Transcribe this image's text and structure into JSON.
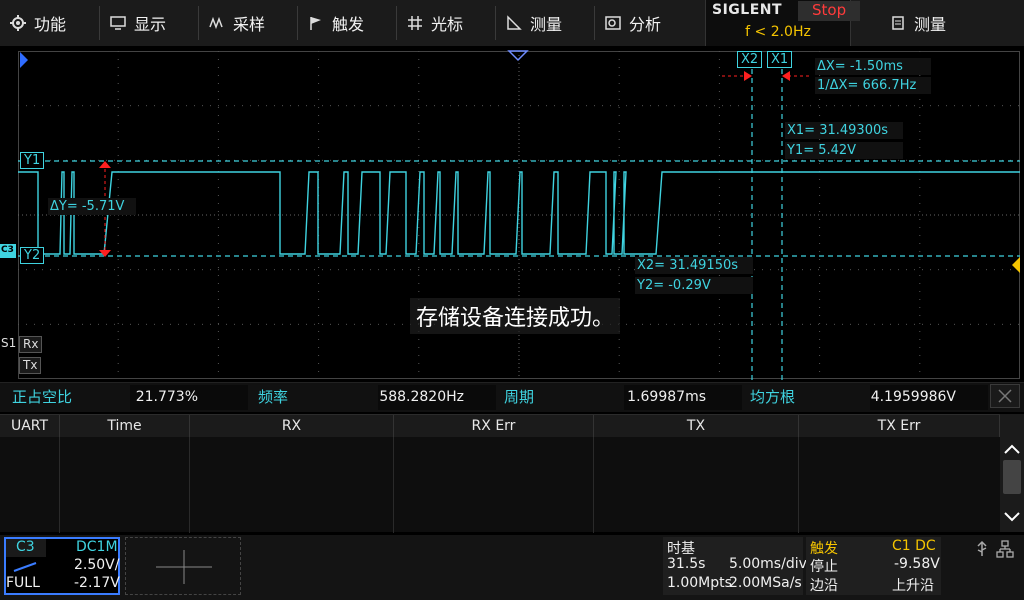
{
  "menu": [
    {
      "label": "功能",
      "icon": "gear-icon"
    },
    {
      "label": "显示",
      "icon": "monitor-icon"
    },
    {
      "label": "采样",
      "icon": "sample-icon"
    },
    {
      "label": "触发",
      "icon": "flag-icon"
    },
    {
      "label": "光标",
      "icon": "cursor-icon"
    },
    {
      "label": "测量",
      "icon": "ruler-icon"
    },
    {
      "label": "分析",
      "icon": "analyze-icon"
    }
  ],
  "brand": "SIGLENT",
  "run_state": "Stop",
  "trigger_freq": "f < 2.0Hz",
  "right_menu": {
    "label": "测量",
    "icon": "list-icon"
  },
  "cursors": {
    "x1_tag": "X1",
    "x2_tag": "X2",
    "y1_tag": "Y1",
    "y2_tag": "Y2",
    "delta_x": "ΔX= -1.50ms",
    "inv_delta_x": "1/ΔX= 666.7Hz",
    "x1_value": "X1= 31.49300s",
    "y1_value": "Y1= 5.42V",
    "x2_value": "X2= 31.49150s",
    "y2_value": "Y2= -0.29V",
    "delta_y": "ΔY= -5.71V"
  },
  "channel_marker": "C3",
  "serial_marker": {
    "bus": "S1",
    "rx": "Rx",
    "tx": "Tx"
  },
  "message": "存储设备连接成功。",
  "measurements": [
    {
      "name": "正占空比",
      "value": "21.773%"
    },
    {
      "name": "频率",
      "value": "588.2820Hz"
    },
    {
      "name": "周期",
      "value": "1.69987ms"
    },
    {
      "name": "均方根",
      "value": "4.1959986V"
    }
  ],
  "decode_table": {
    "columns": [
      "UART",
      "Time",
      "RX",
      "RX Err",
      "TX",
      "TX Err"
    ]
  },
  "channel": {
    "name": "C3",
    "coupling": "DC1M",
    "scale": "2.50V/",
    "bandwidth": "FULL",
    "offset": "-2.17V"
  },
  "timebase": {
    "title": "时基",
    "delay": "31.5s",
    "scale": "5.00ms/div",
    "memory": "1.00Mpts",
    "sample_rate": "2.00MSa/s"
  },
  "trigger": {
    "title": "触发",
    "source": "C1 DC",
    "state": "停止",
    "level": "-9.58V",
    "type": "边沿",
    "slope": "上升沿"
  },
  "colors": {
    "accent": "#3fd3e0",
    "trigger": "#f5c400",
    "stop": "#ff3b3b",
    "cursor_arrow": "#ff2020"
  }
}
